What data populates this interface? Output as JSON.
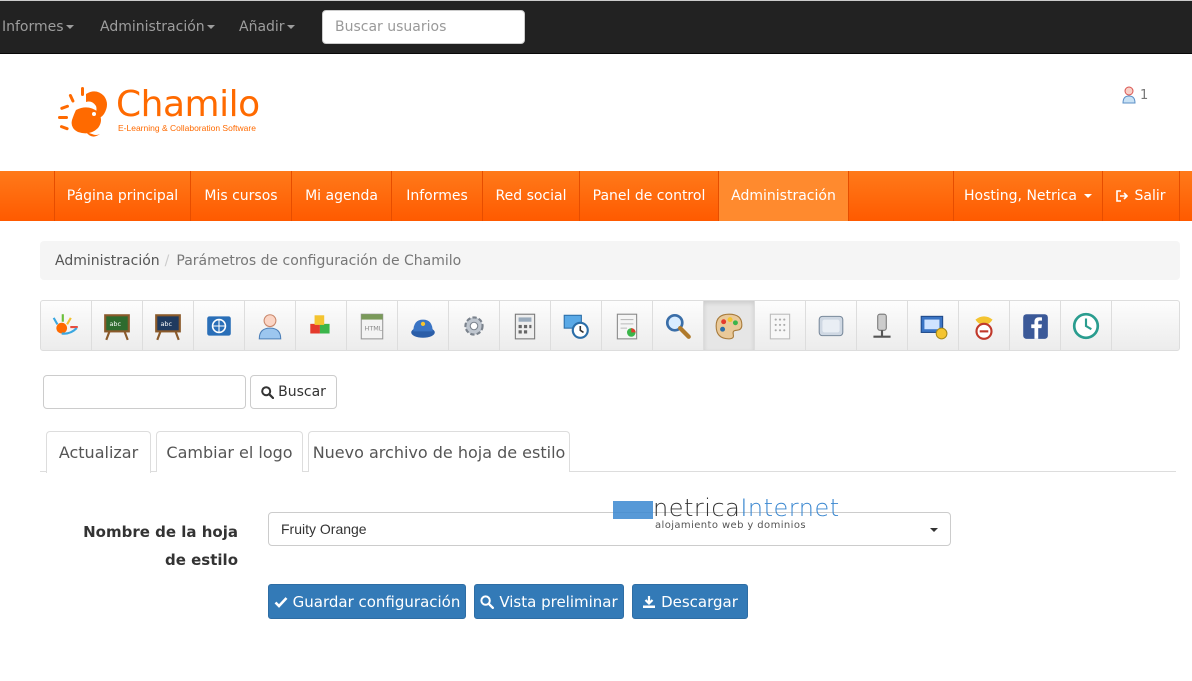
{
  "topbar": {
    "menus": [
      {
        "label": "Informes"
      },
      {
        "label": "Administración"
      },
      {
        "label": "Añadir"
      }
    ],
    "search_placeholder": "Buscar usuarios"
  },
  "header": {
    "logo_word": "Chamilo",
    "logo_tagline": "E-Learning & Collaboration Software",
    "notification_count": "1"
  },
  "nav": {
    "items": [
      {
        "label": "Página principal"
      },
      {
        "label": "Mis cursos"
      },
      {
        "label": "Mi agenda"
      },
      {
        "label": "Informes"
      },
      {
        "label": "Red social"
      },
      {
        "label": "Panel de control"
      },
      {
        "label": "Administración",
        "active": true
      }
    ],
    "user_label": "Hosting, Netrica",
    "logout_label": "Salir"
  },
  "breadcrumb": {
    "parent": "Administración",
    "current": "Parámetros de configuración de Chamilo"
  },
  "toolbar": {
    "selected_index": 13,
    "icons": [
      "platform-icon",
      "course-board-icon",
      "session-board-icon",
      "languages-icon",
      "user-icon",
      "plugins-icon",
      "html-editor-icon",
      "security-icon",
      "advanced-settings-icon",
      "calculator-icon",
      "clock-world-icon",
      "reports-icon",
      "search-icon",
      "stylesheets-icon",
      "templates-icon",
      "cas-icon",
      "ldap-icon",
      "ticket-icon",
      "shibboleth-icon",
      "facebook-icon",
      "time-icon"
    ]
  },
  "search": {
    "button_label": "Buscar"
  },
  "tabs": [
    {
      "label": "Actualizar",
      "active": true
    },
    {
      "label": "Cambiar el logo"
    },
    {
      "label": "Nuevo archivo de hoja de estilo"
    }
  ],
  "form": {
    "label_line1": "Nombre de la hoja",
    "label_line2": "de estilo",
    "selected_value": "Fruity Orange",
    "save_label": "Guardar configuración",
    "preview_label": "Vista preliminar",
    "download_label": "Descargar"
  },
  "watermark": {
    "brand_a": "netrica",
    "brand_b": "Internet",
    "subtitle": "alojamiento web y dominios"
  },
  "colors": {
    "accent_orange": "#ff6a00",
    "primary_blue": "#337ab7",
    "topbar_bg": "#222222"
  }
}
